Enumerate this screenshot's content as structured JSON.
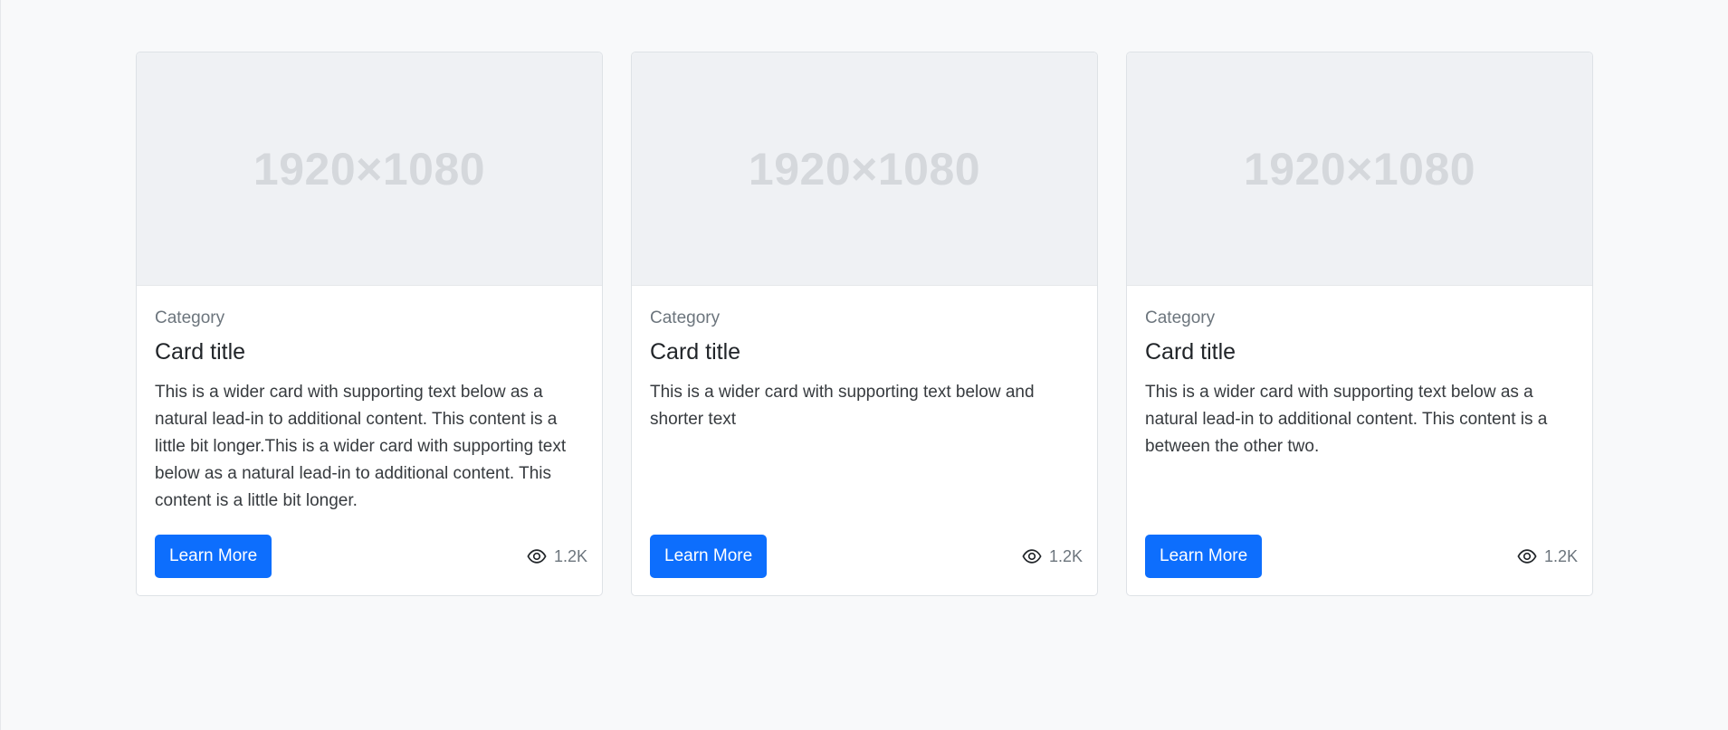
{
  "cards": [
    {
      "image_label": "1920×1080",
      "category": "Category",
      "title": "Card title",
      "text": "This is a wider card with supporting text below as a natural lead-in to additional content. This content is a little bit longer.This is a wider card with supporting text below as a natural lead-in to additional content. This content is a little bit longer.",
      "button_label": "Learn More",
      "views": "1.2K",
      "views_icon": "eye-icon"
    },
    {
      "image_label": "1920×1080",
      "category": "Category",
      "title": "Card title",
      "text": "This is a wider card with supporting text below and shorter text",
      "button_label": "Learn More",
      "views": "1.2K",
      "views_icon": "eye-icon"
    },
    {
      "image_label": "1920×1080",
      "category": "Category",
      "title": "Card title",
      "text": "This is a wider card with supporting text below as a natural lead-in to additional content. This content is a between the other two.",
      "button_label": "Learn More",
      "views": "1.2K",
      "views_icon": "eye-icon"
    }
  ],
  "colors": {
    "accent": "#0d6efd",
    "background": "#f8f9fa",
    "muted_text": "#6c757d",
    "image_placeholder": "#eff1f4"
  }
}
